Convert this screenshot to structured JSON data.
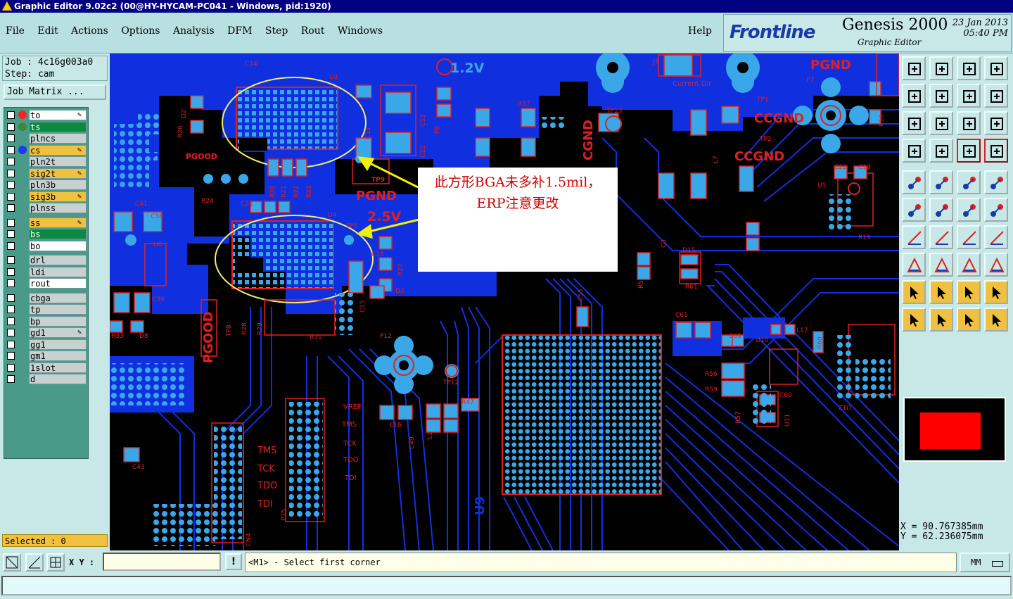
{
  "window": {
    "title": "Graphic Editor 9.02c2 (00@HY-HYCAM-PC041 - Windows, pid:1920)"
  },
  "menu": [
    "File",
    "Edit",
    "Actions",
    "Options",
    "Analysis",
    "DFM",
    "Step",
    "Rout",
    "Windows"
  ],
  "help": "Help",
  "brand": {
    "logo": "Frontline",
    "product": "Genesis 2000",
    "subtitle": "Graphic Editor",
    "date": "23 Jan 2013",
    "time": "05:40 PM"
  },
  "job": {
    "job_label": "Job : 4c16g003a0",
    "step_label": "Step: cam",
    "matrix_button": "Job Matrix ..."
  },
  "layers": [
    {
      "name": "to",
      "dot": "#ff2020",
      "style": "w",
      "pen": true
    },
    {
      "name": "ts",
      "dot": "#3a8a3a",
      "style": "g",
      "pen": false
    },
    {
      "name": "plncs",
      "dot": "",
      "style": "gr",
      "pen": false
    },
    {
      "name": "cs",
      "dot": "#1a3aff",
      "style": "y",
      "pen": true
    },
    {
      "name": "pln2t",
      "dot": "",
      "style": "gr",
      "pen": false
    },
    {
      "name": "sig2t",
      "dot": "",
      "style": "y",
      "pen": true
    },
    {
      "name": "pln3b",
      "dot": "",
      "style": "gr",
      "pen": false
    },
    {
      "name": "sig3b",
      "dot": "",
      "style": "y",
      "pen": true
    },
    {
      "name": "plnss",
      "dot": "",
      "style": "gr",
      "pen": false
    },
    {
      "name": "ss",
      "dot": "",
      "style": "y",
      "pen": true
    },
    {
      "name": "bs",
      "dot": "",
      "style": "g",
      "pen": false
    },
    {
      "name": "bo",
      "dot": "",
      "style": "w",
      "pen": false
    },
    {
      "name": "drl",
      "dot": "",
      "style": "gr",
      "pen": false
    },
    {
      "name": "ldi",
      "dot": "",
      "style": "gr",
      "pen": false
    },
    {
      "name": "rout",
      "dot": "",
      "style": "w",
      "pen": false
    },
    {
      "name": "cbga",
      "dot": "",
      "style": "gr",
      "pen": false
    },
    {
      "name": "tp",
      "dot": "",
      "style": "gr",
      "pen": false
    },
    {
      "name": "bp",
      "dot": "",
      "style": "gr",
      "pen": false
    },
    {
      "name": "gd1",
      "dot": "",
      "style": "gr",
      "pen": true
    },
    {
      "name": "gg1",
      "dot": "",
      "style": "gr",
      "pen": false
    },
    {
      "name": "gm1",
      "dot": "",
      "style": "gr",
      "pen": false
    },
    {
      "name": "1slot",
      "dot": "",
      "style": "gr",
      "pen": false
    },
    {
      "name": "d",
      "dot": "",
      "style": "gr",
      "pen": false
    }
  ],
  "selected": "Selected : 0",
  "canvas": {
    "labels": {
      "c14": "C14",
      "u3": "U3",
      "v12": "1.2V",
      "j2": "J2",
      "pgnd_top": "PGND",
      "p7": "P7",
      "current_dir": "Current Dir",
      "tp13": "TP13",
      "cgnd": "CGND",
      "tp1": "TP1",
      "ccgnd1": "CCGND",
      "tp2": "TP2",
      "ccgnd2": "CCGND",
      "r17": "R17",
      "c13": "C13",
      "c12": "C12",
      "c11": "C11",
      "p8": "P8",
      "d2": "D2",
      "r26": "R26",
      "pgood": "PGOOD",
      "tp9": "TP9",
      "pgnd_mid": "PGND",
      "v25": "2.5V",
      "r24": "R24",
      "c21": "C21",
      "u4": "U4",
      "tp5": "TP5",
      "c18": "C18",
      "r27": "R27",
      "d3": "D3",
      "c15": "C15",
      "c41": "C41",
      "c38": "C38",
      "u6": "U6",
      "c39": "C39",
      "r33": "R33",
      "d8": "D8",
      "pgood_big": "PGOOD",
      "tp8": "TP8",
      "r28": "R28",
      "r29": "R29",
      "r31": "R31",
      "c61": "C61",
      "c69": "C69",
      "u10": "U10",
      "l17": "L17",
      "r60": "R60",
      "r56": "R56",
      "r59": "R59",
      "c60": "C60",
      "r57": "R57",
      "u11": "U11",
      "u12": "U12",
      "u5": "U5",
      "c22": "C22",
      "c19": "C19",
      "r19": "R19",
      "c3": "C3",
      "d15": "D15",
      "r61": "R61",
      "r5": "R5",
      "c55": "C55",
      "l7": "L7",
      "r16": "R16",
      "p12": "P12",
      "tp12": "TP12",
      "r47": "R47",
      "l16": "L16",
      "c49": "C49",
      "l1": "L1",
      "vref": "VREF",
      "tms": "TMS",
      "tck": "TCK",
      "tdo": "TDO",
      "tdi": "TDI",
      "tms2": "TMS",
      "tck2": "TCK",
      "tdo2": "TDO",
      "tdi2": "TDI",
      "c43": "C43",
      "cn4": "CN4",
      "p15": "P15",
      "u9": "U9",
      "r20": "R20",
      "r21": "R21",
      "r22": "R22",
      "r23": "R23"
    },
    "annotation": "此方形BGA未多补1.5mil，ERP注意更改"
  },
  "coords": {
    "x": "X  =  90.767385mm",
    "y": "Y  =  62.236075mm"
  },
  "bottom": {
    "xy_label": "X Y :",
    "xy_value": "",
    "prompt": "<M1> - Select first corner",
    "units": "MM"
  },
  "colors": {
    "board_blue": "#1030e0",
    "copper": "#3aa8e8",
    "outline_red": "#e02020",
    "annotation_yellow": "#f0f000"
  }
}
